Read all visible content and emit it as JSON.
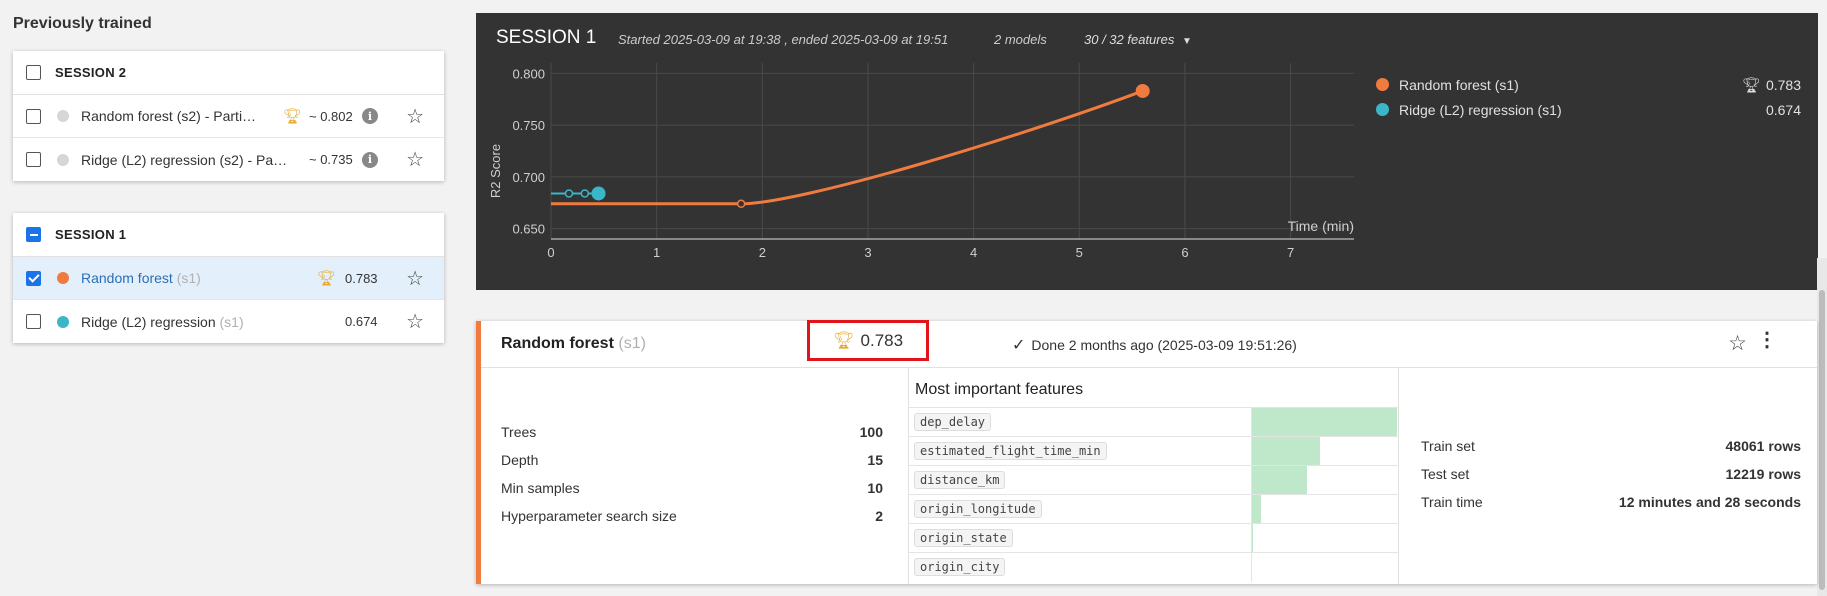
{
  "left": {
    "title": "Previously trained",
    "sessions": [
      {
        "label": "SESSION 2",
        "models": [
          {
            "name": "Random forest (s2) - Parti…",
            "tag": "",
            "score": "~ 0.802",
            "best": true,
            "info": true,
            "dot_color": "#d6d6d6"
          },
          {
            "name": "Ridge (L2) regression (s2) - Pa…",
            "tag": "",
            "score": "~ 0.735",
            "best": false,
            "info": true,
            "dot_color": "#d6d6d6"
          }
        ]
      },
      {
        "label": "SESSION 1",
        "models": [
          {
            "name": "Random forest",
            "tag": "(s1)",
            "score": "0.783",
            "best": true,
            "info": false,
            "dot_color": "#f07b3f",
            "checked": true
          },
          {
            "name": "Ridge (L2) regression",
            "tag": "(s1)",
            "score": "0.674",
            "best": false,
            "info": false,
            "dot_color": "#3bb6c9",
            "checked": false
          }
        ]
      }
    ]
  },
  "chart_header": {
    "title": "SESSION 1",
    "started": "Started 2025-03-09 at 19:38 , ended 2025-03-09 at 19:51",
    "models": "2 models",
    "features": "30 / 32 features"
  },
  "chart_data": {
    "type": "line",
    "xlabel": "Time (min)",
    "ylabel": "R2 Score",
    "xlim": [
      0,
      7.6
    ],
    "ylim": [
      0.64,
      0.81
    ],
    "x_ticks": [
      "0",
      "1",
      "2",
      "3",
      "4",
      "5",
      "6",
      "7"
    ],
    "y_ticks": [
      "0.650",
      "0.700",
      "0.750",
      "0.800"
    ],
    "series": [
      {
        "name": "Random forest (s1)",
        "color": "#f07b3f",
        "points": [
          [
            0.0,
            0.674
          ],
          [
            1.8,
            0.674
          ],
          [
            5.6,
            0.783
          ]
        ]
      },
      {
        "name": "Ridge (L2) regression (s1)",
        "color": "#3bb6c9",
        "points": [
          [
            0.0,
            0.684
          ],
          [
            0.17,
            0.684
          ],
          [
            0.32,
            0.684
          ],
          [
            0.45,
            0.684
          ]
        ]
      }
    ],
    "legend": [
      {
        "name": "Random forest (s1)",
        "score": "0.783",
        "best": true,
        "color": "#f07b3f"
      },
      {
        "name": "Ridge (L2) regression (s1)",
        "score": "0.674",
        "best": false,
        "color": "#3bb6c9"
      }
    ]
  },
  "detail": {
    "title": "Random forest",
    "tag": "(s1)",
    "score": "0.783",
    "done": "Done 2 months ago (2025-03-09 19:51:26)",
    "params": [
      {
        "label": "Trees",
        "value": "100"
      },
      {
        "label": "Depth",
        "value": "15"
      },
      {
        "label": "Min samples",
        "value": "10"
      },
      {
        "label": "Hyperparameter search size",
        "value": "2"
      }
    ],
    "features_title": "Most important features",
    "features": [
      {
        "name": "dep_delay",
        "importance": 1.0
      },
      {
        "name": "estimated_flight_time_min",
        "importance": 0.47
      },
      {
        "name": "distance_km",
        "importance": 0.38
      },
      {
        "name": "origin_longitude",
        "importance": 0.06
      },
      {
        "name": "origin_state",
        "importance": 0.01
      },
      {
        "name": "origin_city",
        "importance": 0.0
      }
    ],
    "split": [
      {
        "label": "Train set",
        "value": "48061 rows"
      },
      {
        "label": "Test set",
        "value": "12219 rows"
      },
      {
        "label": "Train time",
        "value": "12 minutes and 28 seconds"
      }
    ]
  }
}
